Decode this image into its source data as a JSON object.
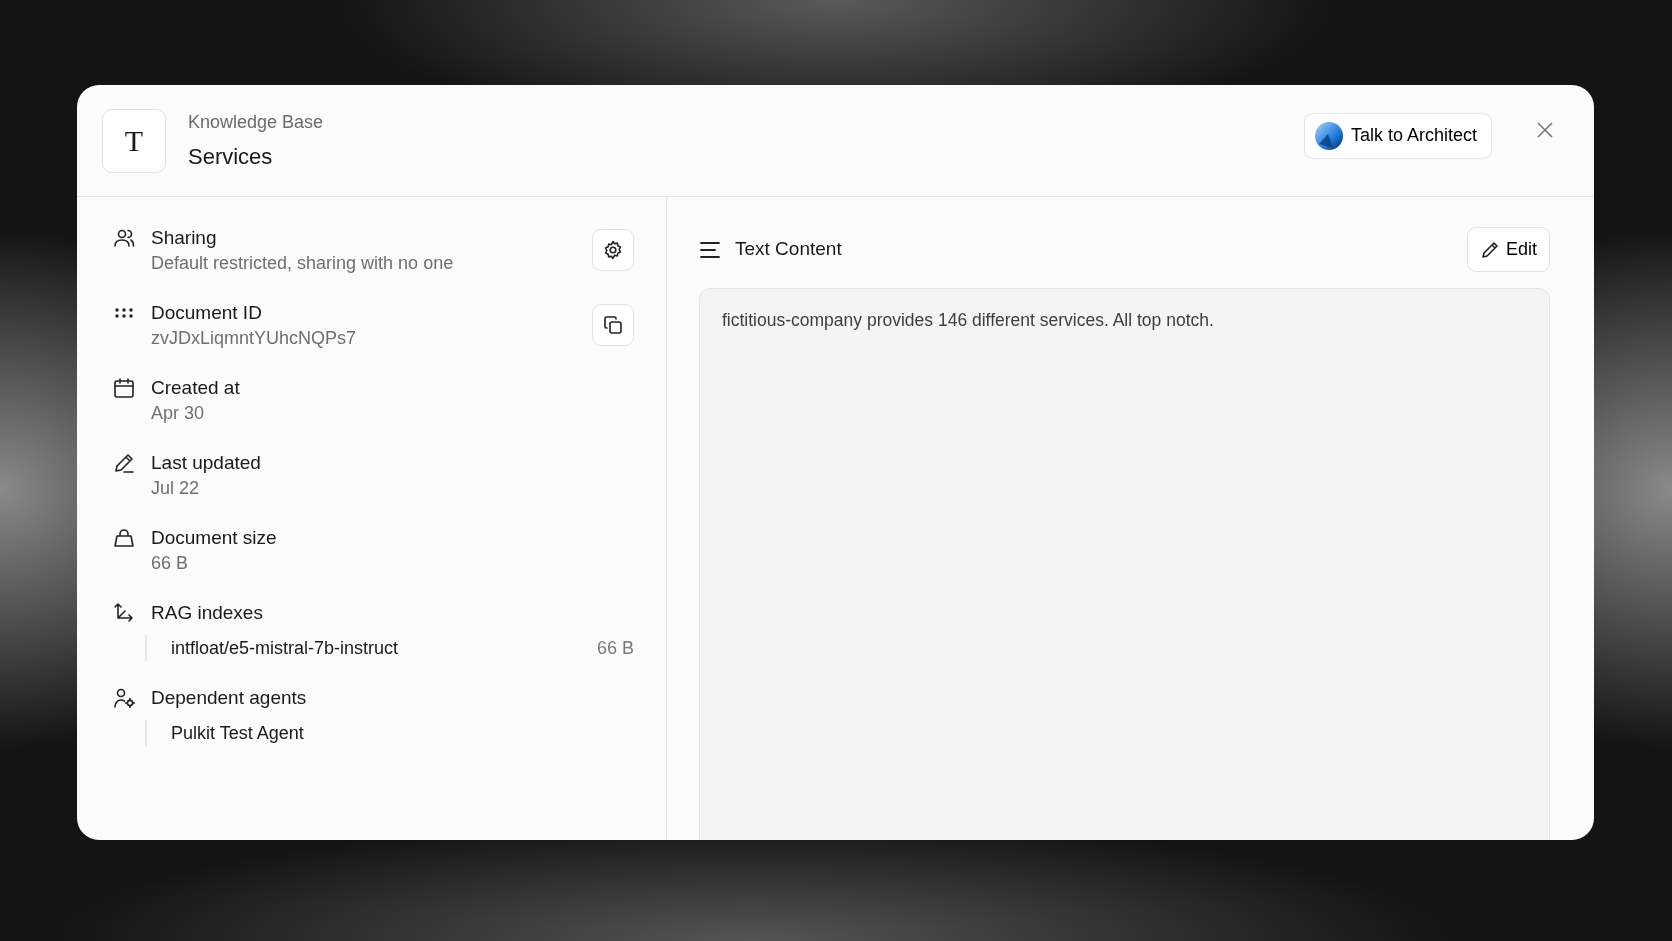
{
  "header": {
    "subtitle": "Knowledge Base",
    "title": "Services",
    "avatar_letter": "T",
    "talk_button": "Talk to Architect"
  },
  "details": [
    {
      "kind": "sharing",
      "label": "Sharing",
      "value": "Default restricted, sharing with no one"
    },
    {
      "kind": "id",
      "label": "Document ID",
      "value": "zvJDxLiqmntYUhcNQPs7"
    },
    {
      "kind": "created",
      "label": "Created at",
      "value": "Apr 30"
    },
    {
      "kind": "updated",
      "label": "Last updated",
      "value": "Jul 22"
    },
    {
      "kind": "size",
      "label": "Document size",
      "value": "66 B"
    },
    {
      "kind": "rag",
      "label": "RAG indexes",
      "children": [
        {
          "label": "intfloat/e5-mistral-7b-instruct",
          "size": "66 B"
        }
      ]
    },
    {
      "kind": "agents",
      "label": "Dependent agents",
      "children": [
        {
          "label": "Pulkit Test Agent"
        }
      ]
    }
  ],
  "content": {
    "title": "Text Content",
    "edit_button": "Edit",
    "text": "fictitious-company provides 146 different services. All top notch."
  }
}
